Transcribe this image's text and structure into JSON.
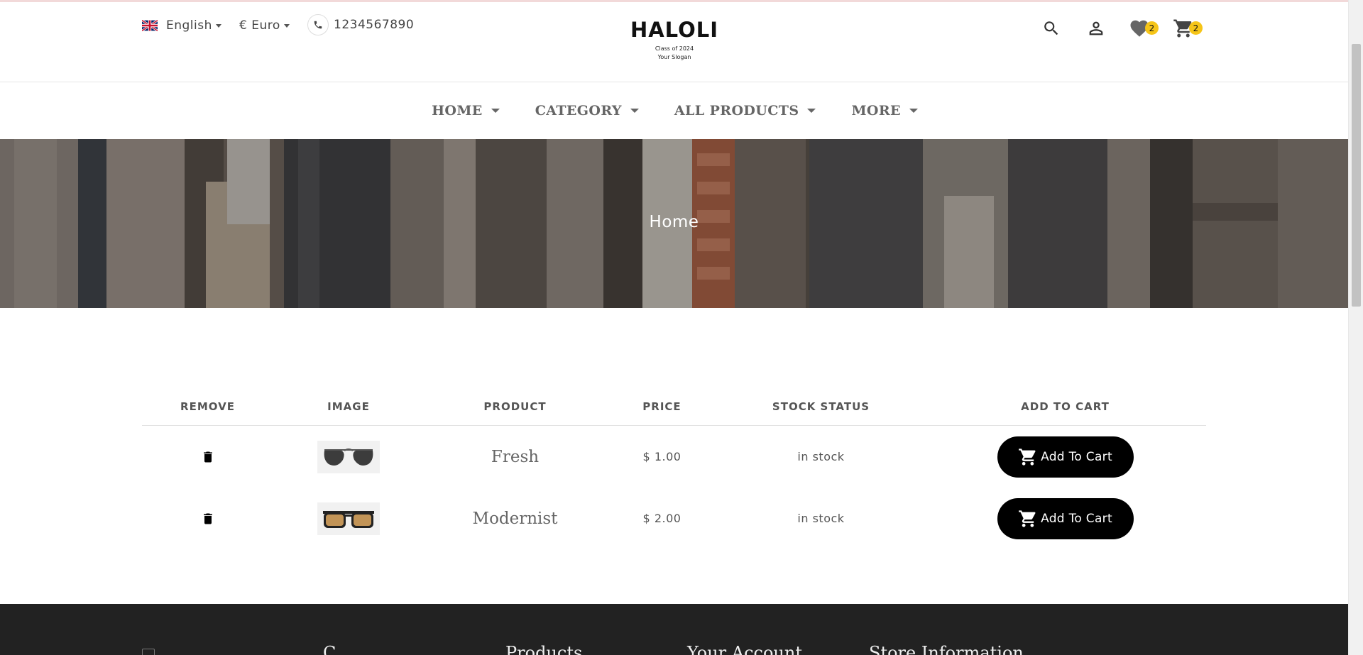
{
  "header": {
    "language": "English",
    "currency": "€ Euro",
    "phone": "1234567890",
    "logo_title": "HALOLI",
    "logo_line1": "Class of 2024",
    "logo_line2": "Your Slogan",
    "wishlist_count": "2",
    "cart_count": "2"
  },
  "nav": {
    "items": [
      {
        "label": "HOME"
      },
      {
        "label": "CATEGORY"
      },
      {
        "label": "ALL PRODUCTS"
      },
      {
        "label": "MORE"
      }
    ]
  },
  "banner": {
    "title": "Home"
  },
  "wishlist": {
    "columns": [
      "REMOVE",
      "IMAGE",
      "PRODUCT",
      "PRICE",
      "STOCK STATUS",
      "ADD TO CART"
    ],
    "rows": [
      {
        "product": "Fresh",
        "price": "$ 1.00",
        "stock": "in stock",
        "button": "Add To Cart",
        "image_icon": "aviator-sunglasses"
      },
      {
        "product": "Modernist",
        "price": "$ 2.00",
        "stock": "in stock",
        "button": "Add To Cart",
        "image_icon": "amber-sunglasses"
      }
    ]
  },
  "footer": {
    "columns": [
      "C",
      "Products",
      "Your Account",
      "Store Information"
    ]
  },
  "colors": {
    "badge": "#f6c518",
    "button": "#000000",
    "footer": "#222222"
  }
}
